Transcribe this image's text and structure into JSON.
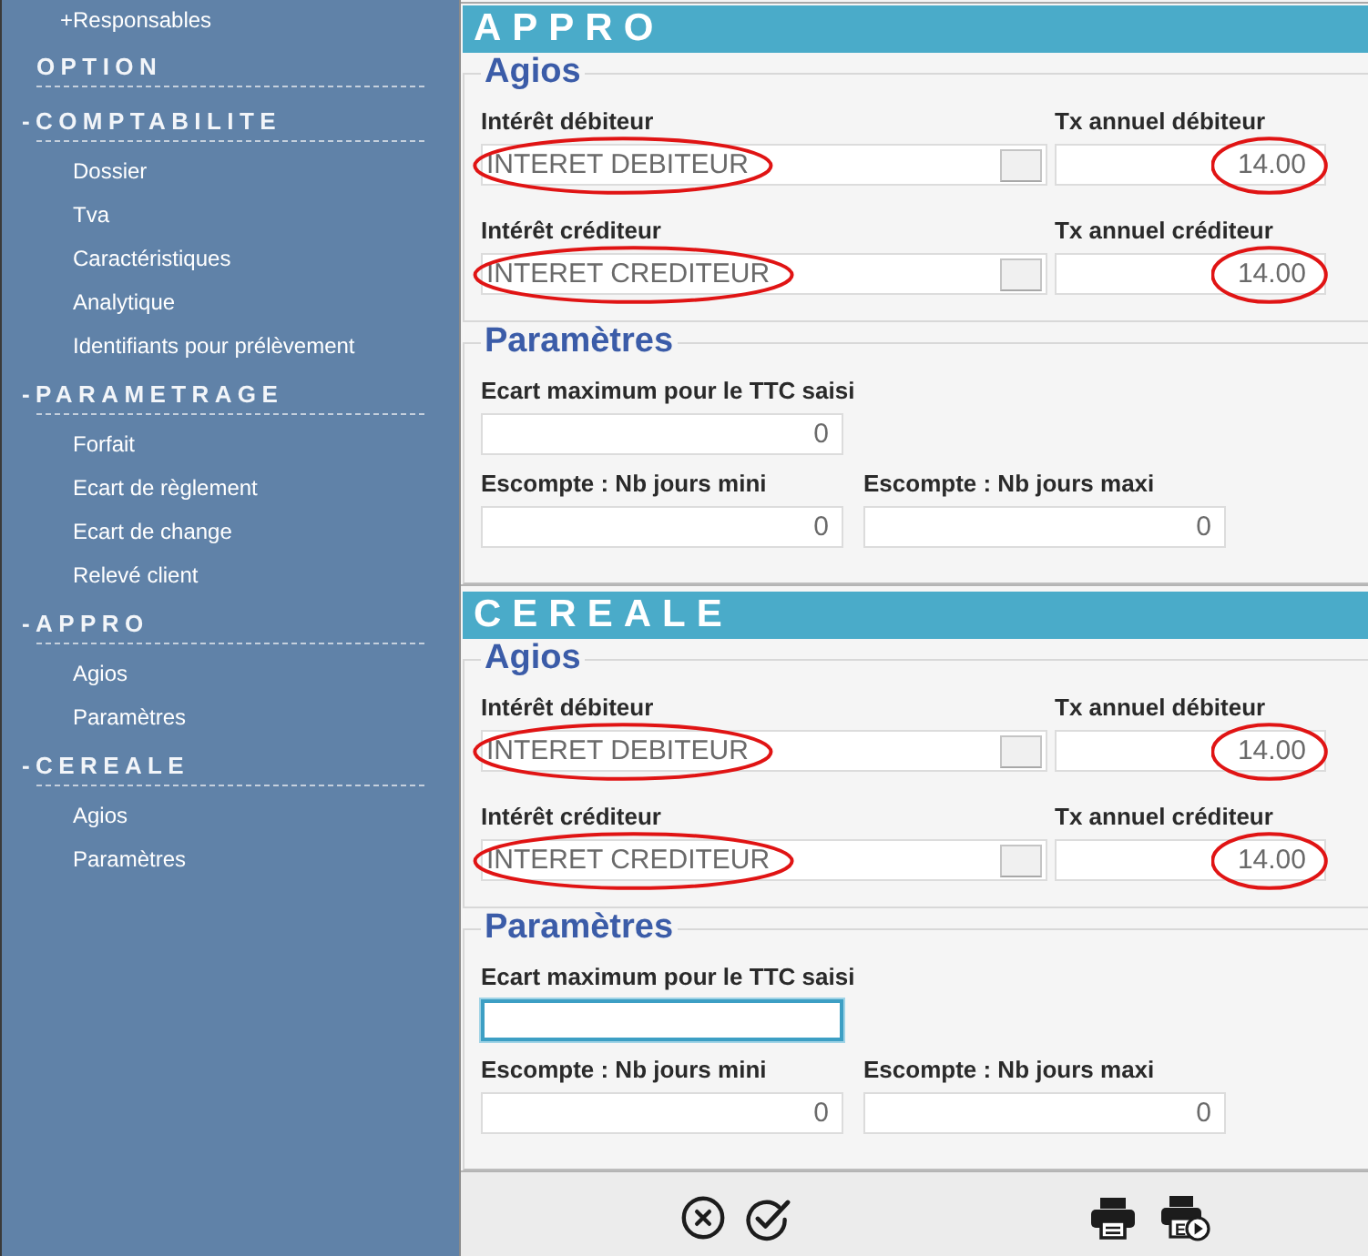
{
  "sidebar": {
    "items": [
      {
        "label": "+Responsables",
        "kind": "collapsed"
      },
      {
        "label": "OPTION",
        "kind": "section"
      },
      {
        "label": "-COMPTABILITE",
        "kind": "group",
        "children": [
          {
            "label": "Dossier"
          },
          {
            "label": "Tva"
          },
          {
            "label": "Caractéristiques"
          },
          {
            "label": "Analytique"
          },
          {
            "label": "Identifiants pour prélèvement"
          }
        ]
      },
      {
        "label": "-PARAMETRAGE",
        "kind": "group",
        "children": [
          {
            "label": "Forfait"
          },
          {
            "label": "Ecart de règlement"
          },
          {
            "label": "Ecart de change"
          },
          {
            "label": "Relevé client"
          }
        ]
      },
      {
        "label": "-APPRO",
        "kind": "group",
        "children": [
          {
            "label": "Agios"
          },
          {
            "label": "Paramètres"
          }
        ]
      },
      {
        "label": "-CEREALE",
        "kind": "group",
        "children": [
          {
            "label": "Agios"
          },
          {
            "label": "Paramètres"
          }
        ]
      }
    ]
  },
  "sections": [
    {
      "title": "APPRO",
      "agios": {
        "legend": "Agios",
        "fields": [
          {
            "kind": "lookup",
            "label": "Intérêt débiteur",
            "value": "INTERET DEBITEUR",
            "circled": true
          },
          {
            "kind": "rate",
            "label": "Tx annuel débiteur",
            "value": "14.00",
            "circled": true
          },
          {
            "kind": "lookup",
            "label": "Intérêt créditeur",
            "value": "INTERET CREDITEUR",
            "circled": true
          },
          {
            "kind": "rate",
            "label": "Tx annuel créditeur",
            "value": "14.00",
            "circled": true
          }
        ]
      },
      "parameters": {
        "legend": "Paramètres",
        "rows": [
          [
            {
              "label": "Ecart maximum pour le TTC saisi",
              "value": "0",
              "focused": false
            }
          ],
          [
            {
              "label": "Escompte : Nb jours mini",
              "value": "0",
              "focused": false
            },
            {
              "label": "Escompte : Nb jours maxi",
              "value": "0",
              "focused": false
            }
          ]
        ]
      }
    },
    {
      "title": "CEREALE",
      "agios": {
        "legend": "Agios",
        "fields": [
          {
            "kind": "lookup",
            "label": "Intérêt débiteur",
            "value": "INTERET DEBITEUR",
            "circled": true
          },
          {
            "kind": "rate",
            "label": "Tx annuel débiteur",
            "value": "14.00",
            "circled": true
          },
          {
            "kind": "lookup",
            "label": "Intérêt créditeur",
            "value": "INTERET CREDITEUR",
            "circled": true
          },
          {
            "kind": "rate",
            "label": "Tx annuel créditeur",
            "value": "14.00",
            "circled": true
          }
        ]
      },
      "parameters": {
        "legend": "Paramètres",
        "rows": [
          [
            {
              "label": "Ecart maximum pour le TTC saisi",
              "focused": true
            }
          ],
          [
            {
              "label": "Escompte : Nb jours mini",
              "value": "0",
              "focused": false
            },
            {
              "label": "Escompte : Nb jours maxi",
              "value": "0",
              "focused": false
            }
          ]
        ]
      }
    }
  ],
  "toolbar": {
    "buttons": [
      {
        "kind": "cancel"
      },
      {
        "kind": "validate"
      },
      {
        "kind": "print"
      },
      {
        "kind": "print-export",
        "mark": "E"
      }
    ]
  }
}
